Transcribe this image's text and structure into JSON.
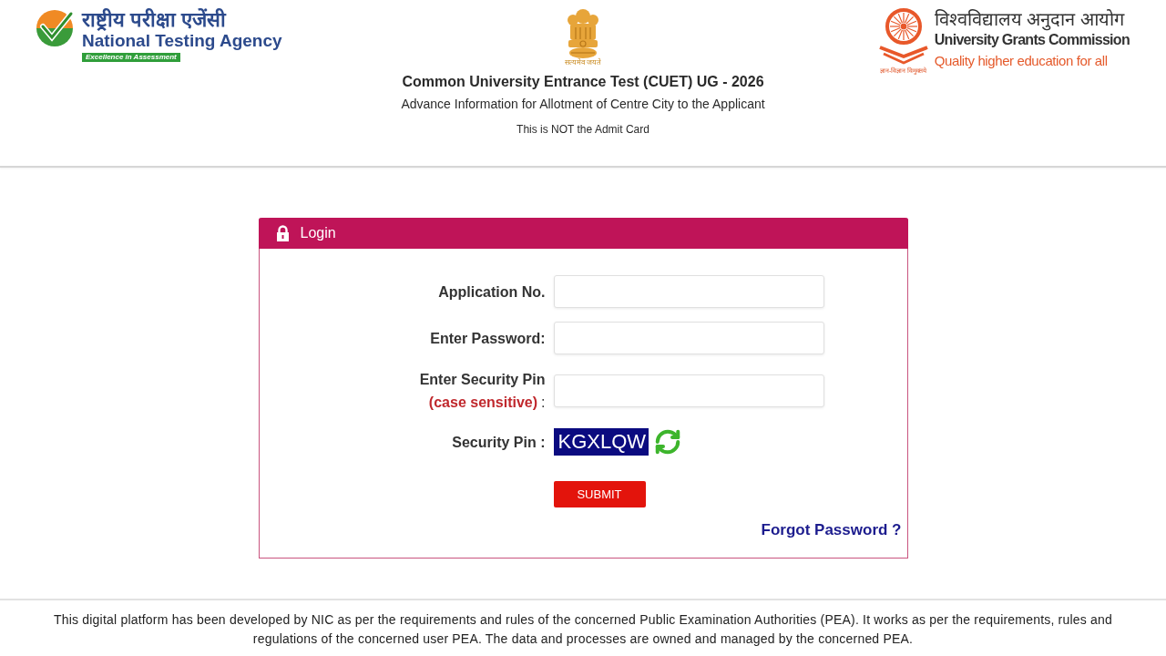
{
  "header": {
    "nta_logo": {
      "hindi_name": "राष्ट्रीय परीक्षा एजेंसी",
      "name": "National Testing Agency",
      "tagline": "Excellence in Assessment"
    },
    "emblem": {
      "motto": "सत्यमेव जयते"
    },
    "title": "Common University Entrance Test (CUET) UG - 2026",
    "subtitle": "Advance Information for Allotment of Centre City to the Applicant",
    "notice": "This is NOT the Admit Card",
    "ugc_logo": {
      "motto": "ज्ञान-विज्ञान विमुक्तये",
      "hindi_name": "विश्वविद्यालय अनुदान आयोग",
      "name": "University Grants Commission",
      "tagline": "Quality higher education for all"
    }
  },
  "login_panel": {
    "title": "Login",
    "fields": [
      {
        "label": "Application No."
      },
      {
        "label": "Enter Password:"
      },
      {
        "label": "Enter Security Pin",
        "note": "(case sensitive)",
        "note_suffix": ":"
      }
    ],
    "captcha": {
      "label": "Security Pin :",
      "code": "KGXLQW"
    },
    "submit_button": "SUBMIT",
    "forgot_link": "Forgot Password ?"
  },
  "footer": {
    "text": "This digital platform has been developed by NIC as per the requirements and rules of the concerned Public Examination Authorities (PEA). It works as per the requirements, rules and regulations of the concerned user PEA. The data and processes are owned and managed by the concerned PEA."
  }
}
